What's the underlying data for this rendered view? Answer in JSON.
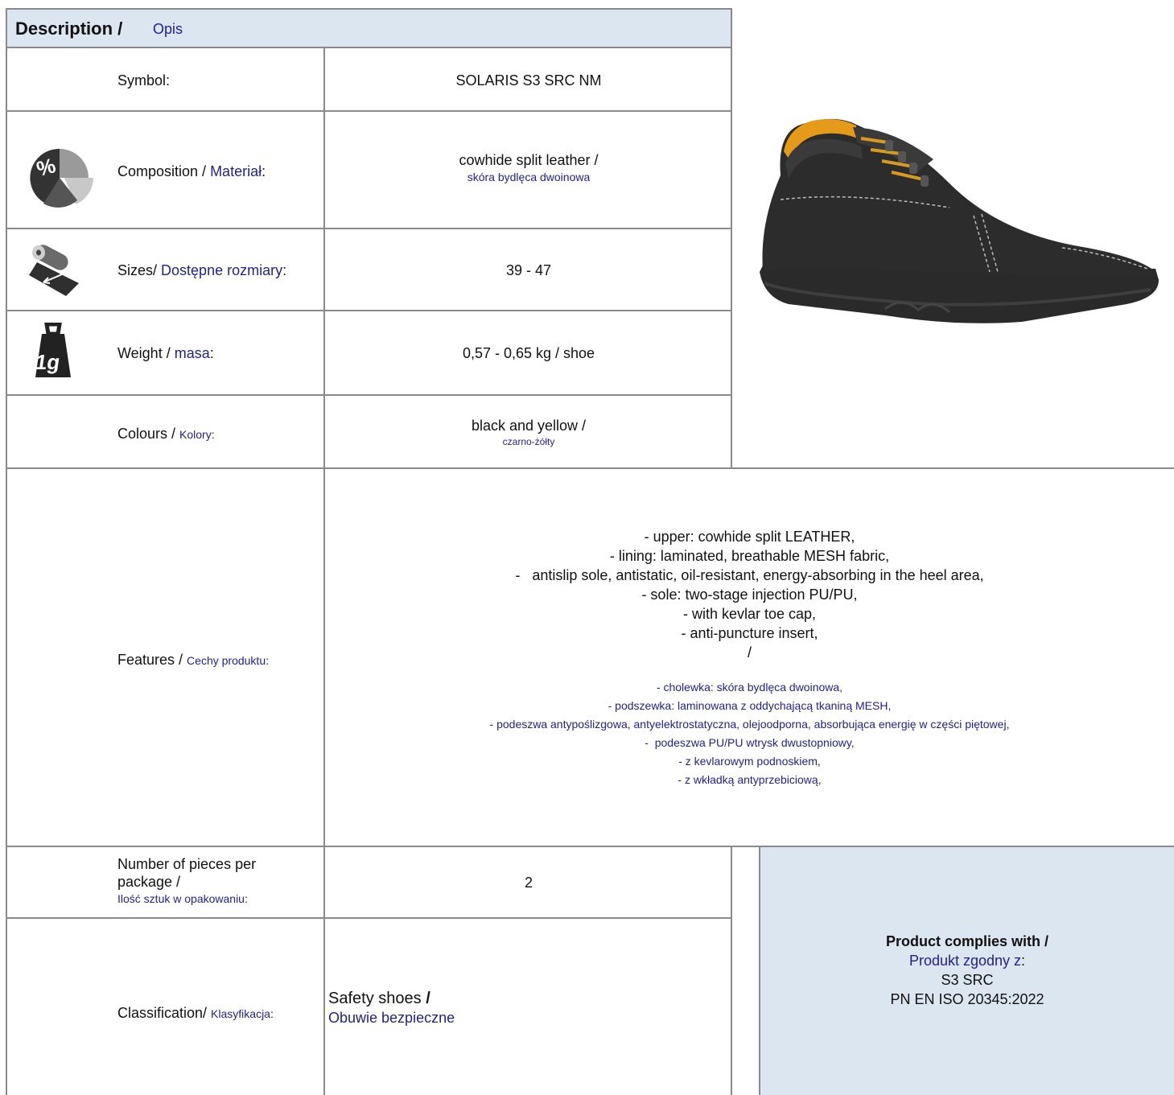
{
  "header": {
    "title_en": "Description /",
    "title_pl": "Opis"
  },
  "rows": {
    "symbol": {
      "label": "Symbol:",
      "value": "SOLARIS S3 SRC NM"
    },
    "composition": {
      "label_en": "Composition / ",
      "label_pl": "Materiał",
      "label_end": ":",
      "value_en": "cowhide split leather /",
      "value_pl": "skóra bydlęca dwoinowa",
      "icon": "pie-chart-percent-icon"
    },
    "sizes": {
      "label_en": "Sizes/ ",
      "label_pl": "Dostępne rozmiary",
      "label_end": ":",
      "value": "39 - 47",
      "icon": "fabric-roll-icon"
    },
    "weight": {
      "label_en": "Weight / ",
      "label_pl": "masa",
      "label_end": ":",
      "value": "0,57 - 0,65 kg / shoe",
      "icon": "weight-1g-icon"
    },
    "colours": {
      "label_en": "Colours / ",
      "label_pl": "Kolory",
      "label_end": ":",
      "value_en": "black and yellow /",
      "value_pl": "czarno-żółty"
    },
    "features": {
      "label_en": "Features / ",
      "label_pl": "Cechy produktu",
      "label_end": ":",
      "lines_en": [
        "- upper: cowhide split LEATHER,",
        "- lining: laminated, breathable MESH fabric,",
        "-   antislip sole, antistatic, oil-resistant, energy-absorbing in the heel area,",
        "- sole: two-stage injection PU/PU,",
        "- with kevlar toe cap,",
        "- anti-puncture insert,",
        "/"
      ],
      "lines_pl": [
        "- cholewka: skóra bydlęca dwoinowa,",
        "- podszewka: laminowana z oddychającą tkaniną MESH,",
        "- podeszwa antypoślizgowa, antyelektrostatyczna, olejoodporna, absorbująca energię w części piętowej,",
        "-  podeszwa PU/PU wtrysk dwustopniowy,",
        "- z kevlarowym podnoskiem,",
        "- z wkładką antyprzebiciową,"
      ]
    },
    "pieces": {
      "label_line1": "Number of pieces per",
      "label_line2": "package /",
      "label_pl": "Ilość sztuk w opakowaniu",
      "label_end": ":",
      "value": "2"
    },
    "classification": {
      "label_en": "Classification/ ",
      "label_pl": "Klasyfikacja",
      "label_end": ":",
      "value_en": "Safety shoes ",
      "value_slash": "/",
      "value_pl": "Obuwie bezpieczne"
    }
  },
  "compliance": {
    "title": "Product complies with /",
    "subtitle_pl": "Produkt zgodny z",
    "subtitle_end": ":",
    "line1": "S3 SRC",
    "line2": "PN EN ISO 20345:2022"
  },
  "colors": {
    "header_bg": "#dce6f1",
    "compliance_bg": "#dce6f1",
    "grid": "#8a8a8a",
    "blue_text": "#1f1f8f"
  }
}
